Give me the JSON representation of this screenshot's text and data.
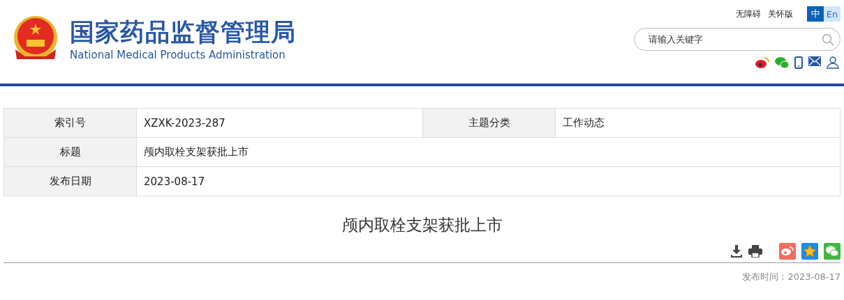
{
  "header": {
    "title": "国家药品监督管理局",
    "subtitle": "National Medical Products Administration"
  },
  "top_links": [
    "无障碍",
    "关怀版"
  ],
  "languages": [
    {
      "label": "中",
      "selected": true
    },
    {
      "label": "En",
      "selected": false
    }
  ],
  "search": {
    "placeholder": "请输入关键字"
  },
  "info_table": {
    "rows": [
      {
        "cells": [
          {
            "kind": "label",
            "text": "索引号"
          },
          {
            "kind": "value",
            "text": "XZXK-2023-287"
          },
          {
            "kind": "label",
            "text": "主题分类"
          },
          {
            "kind": "value",
            "text": "工作动态"
          }
        ]
      },
      {
        "cells": [
          {
            "kind": "label",
            "text": "标题"
          },
          {
            "kind": "value",
            "text": "颅内取栓支架获批上市"
          }
        ]
      },
      {
        "cells": [
          {
            "kind": "label",
            "text": "发布日期"
          },
          {
            "kind": "value",
            "text": "2023-08-17"
          }
        ]
      }
    ]
  },
  "article": {
    "title": "颅内取栓支架获批上市",
    "publish_time": "发布时间：2023-08-17"
  }
}
